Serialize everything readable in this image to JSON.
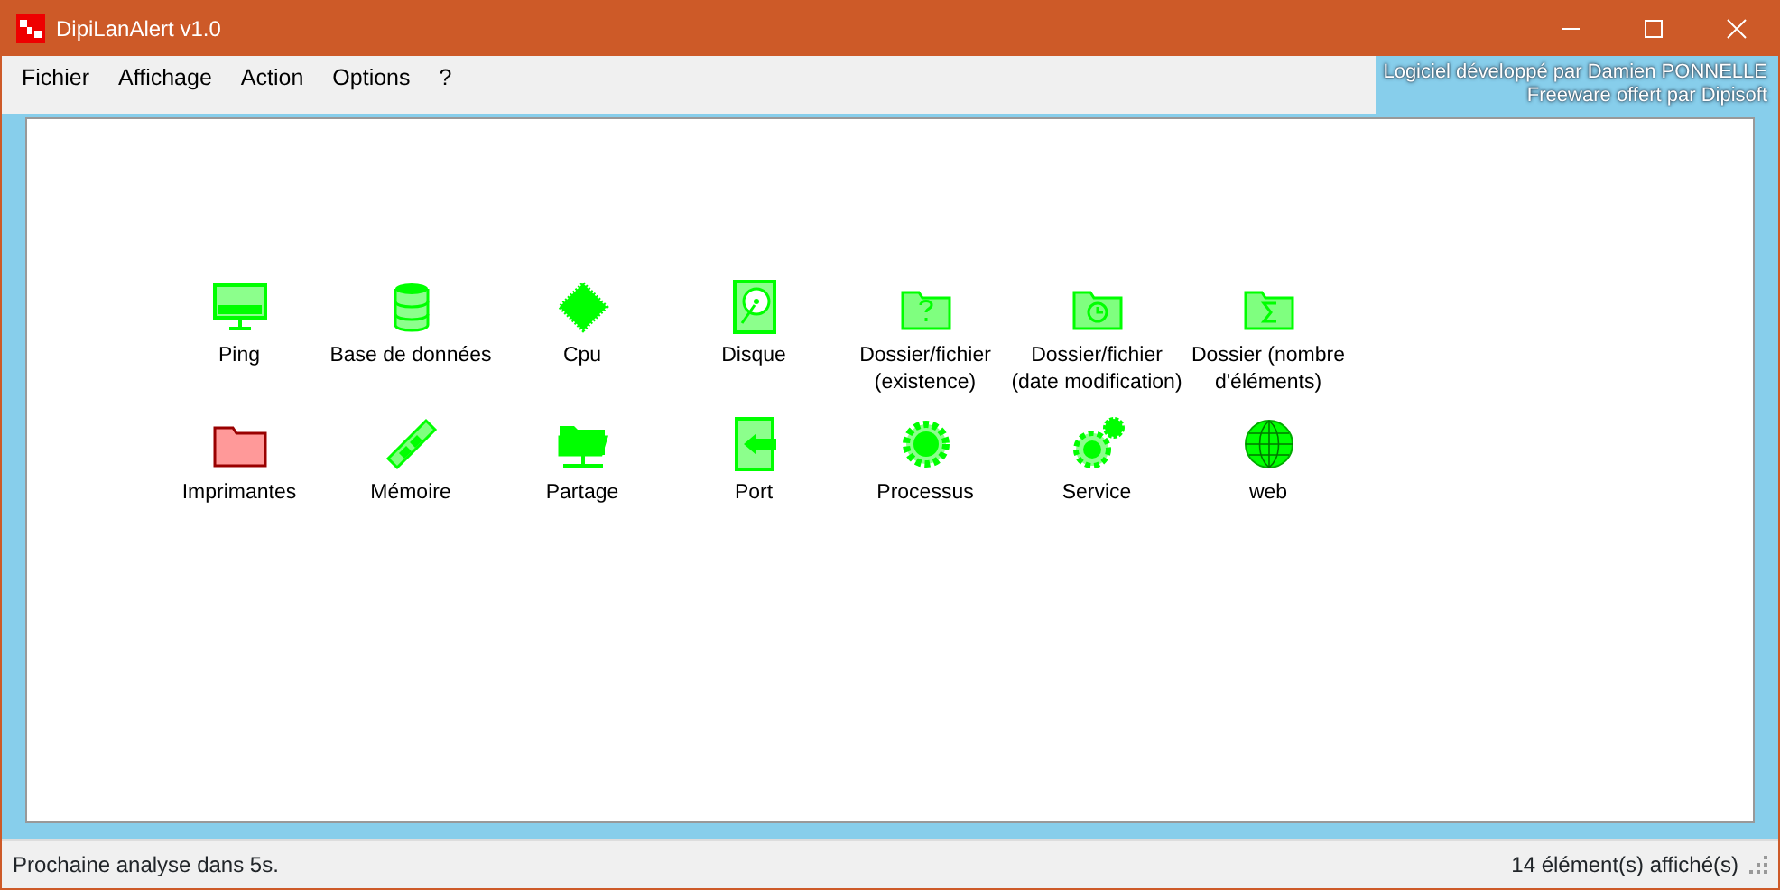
{
  "window": {
    "title": "DipiLanAlert v1.0"
  },
  "menu": [
    "Fichier",
    "Affichage",
    "Action",
    "Options",
    "?"
  ],
  "credits": [
    "Logiciel développé par Damien PONNELLE",
    "Freeware offert par Dipisoft"
  ],
  "items": [
    {
      "label": "Ping",
      "kind": "monitor",
      "color": "#00ff00"
    },
    {
      "label": "Base de données",
      "kind": "database",
      "color": "#00ff00"
    },
    {
      "label": "Cpu",
      "kind": "chip",
      "color": "#00ff00"
    },
    {
      "label": "Disque",
      "kind": "disk",
      "color": "#00ff00"
    },
    {
      "label": "Dossier/fichier (existence)",
      "kind": "folder-question",
      "color": "#00ff00"
    },
    {
      "label": "Dossier/fichier (date modification)",
      "kind": "folder-clock",
      "color": "#00ff00"
    },
    {
      "label": "Dossier (nombre d'éléments)",
      "kind": "folder-sigma",
      "color": "#00ff00"
    },
    {
      "label": "Imprimantes",
      "kind": "folder",
      "color": "#ff9999"
    },
    {
      "label": "Mémoire",
      "kind": "memory",
      "color": "#00ff00"
    },
    {
      "label": "Partage",
      "kind": "folder-share",
      "color": "#00ff00"
    },
    {
      "label": "Port",
      "kind": "port",
      "color": "#00ff00"
    },
    {
      "label": "Processus",
      "kind": "gear",
      "color": "#00ff00"
    },
    {
      "label": "Service",
      "kind": "gears",
      "color": "#00ff00"
    },
    {
      "label": "web",
      "kind": "globe",
      "color": "#00ff00"
    }
  ],
  "status_bar": {
    "left": "Prochaine analyse dans 5s.",
    "right": "14 élément(s) affiché(s)"
  }
}
